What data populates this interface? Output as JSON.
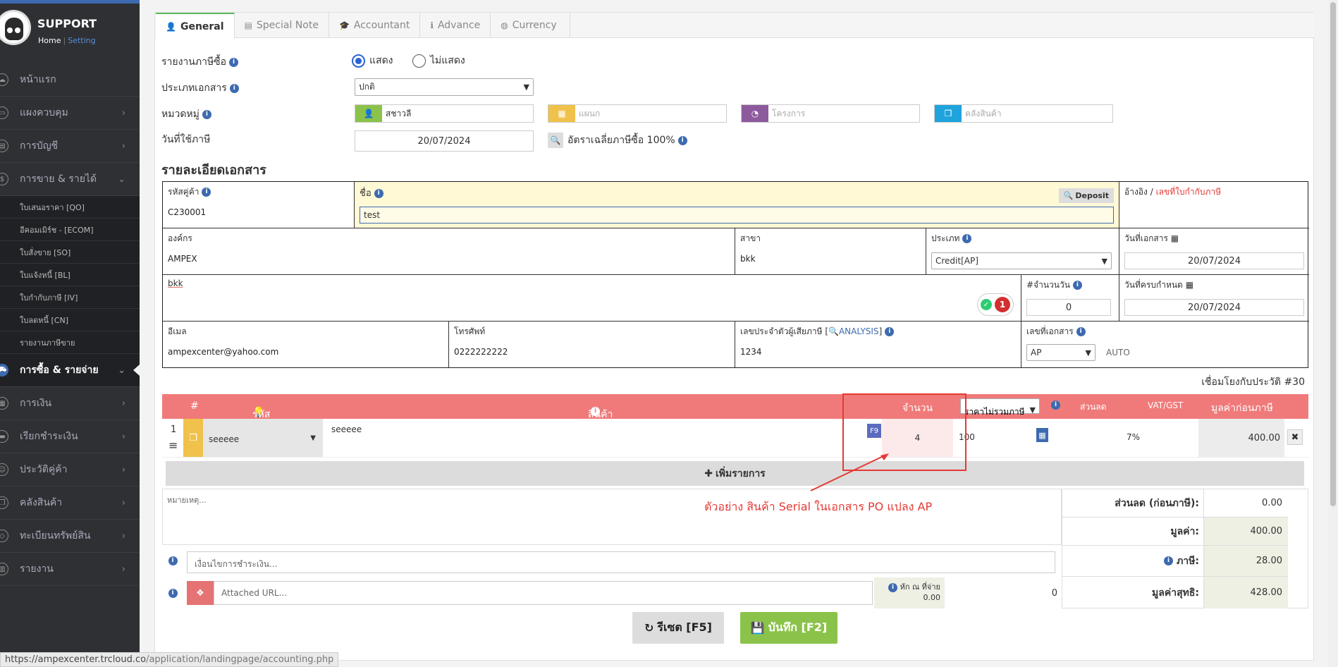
{
  "sidebar": {
    "brand": "SUPPORT",
    "home": "Home",
    "sep": "|",
    "setting": "Setting",
    "menu": [
      {
        "label": "หน้าแรก",
        "icon": "cloud-icon"
      },
      {
        "label": "แผงควบคุม",
        "icon": "monitor-icon"
      },
      {
        "label": "การบัญชี",
        "icon": "book-icon"
      },
      {
        "label": "การขาย & รายได้",
        "icon": "dollar-icon"
      },
      {
        "label": "การซื้อ & รายจ่าย",
        "icon": "cart-icon"
      },
      {
        "label": "การเงิน",
        "icon": "calendar-icon"
      },
      {
        "label": "เรียกชำระเงิน",
        "icon": "card-icon"
      },
      {
        "label": "ประวัติคู่ค้า",
        "icon": "contact-icon"
      },
      {
        "label": "คลังสินค้า",
        "icon": "cubes-icon"
      },
      {
        "label": "ทะเบียนทรัพย์สิน",
        "icon": "diamond-icon"
      },
      {
        "label": "รายงาน",
        "icon": "report-icon"
      }
    ],
    "sales_sub": [
      "ใบเสนอราคา [QO]",
      "อีคอมเมิร์ช - [ECOM]",
      "ใบสั่งขาย [SO]",
      "ใบแจ้งหนี้ [BL]",
      "ใบกำกับภาษี [IV]",
      "ใบลดหนี้ [CN]",
      "รายงานภาษีขาย"
    ]
  },
  "tabs": [
    "General",
    "Special Note",
    "Accountant",
    "Advance",
    "Currency"
  ],
  "form": {
    "tax_report_label": "รายงานภาษีซื้อ",
    "show": "แสดง",
    "hide": "ไม่แสดง",
    "doc_type_label": "ประเภทเอกสาร",
    "doc_type_value": "ปกติ",
    "category_label": "หมวดหมู่",
    "category_person": "สชาวลี",
    "category_dept": "แผนก",
    "category_project": "โครงการ",
    "category_warehouse": "คลังสินค้า",
    "tax_date_label": "วันที่ใช้ภาษี",
    "tax_date": "20/07/2024",
    "avg_tax": "อัตราเฉลี่ยภาษีซื้อ 100%"
  },
  "details": {
    "heading": "รายละเอียดเอกสาร",
    "vendor_code_label": "รหัสคู่ค้า",
    "vendor_code": "C230001",
    "name_label": "ชื่อ",
    "name_value": "test",
    "deposit": "Deposit",
    "ref_label": "อ้างอิง",
    "ref_sep": "/",
    "ref_taxinv": "เลขที่ใบกำกับภาษี",
    "org_label": "องค์กร",
    "org": "AMPEX",
    "branch_label": "สาขา",
    "branch": "bkk",
    "type_label": "ประเภท",
    "type": "Credit[AP]",
    "docdate_label": "วันที่เอกสาร",
    "docdate": "20/07/2024",
    "address": "bkk",
    "badge": "1",
    "days_label": "#จำนวนวัน",
    "days": "0",
    "duedate_label": "วันที่ครบกำหนด",
    "duedate": "20/07/2024",
    "email_label": "อีเมล",
    "email": "ampexcenter@yahoo.com",
    "phone_label": "โทรศัพท์",
    "phone": "0222222222",
    "taxid_label": "เลขประจำตัวผู้เสียภาษี [",
    "analysis": "ANALYSIS",
    "taxid_close": "]",
    "taxid": "1234",
    "docno_label": "เลขที่เอกสาร",
    "docno_prefix": "AP",
    "auto": "AUTO",
    "link_history": "เชื่อมโยงกับประวัติ #30"
  },
  "grid": {
    "headers": {
      "num": "#",
      "code": "รหัส",
      "product": "สินค้า",
      "qty": "จำนวน",
      "price_mode": "ราคาไม่รวมภาษี",
      "discount": "ส่วนลด",
      "vat": "VAT/GST",
      "amount": "มูลค่าก่อนภาษี"
    },
    "rows": [
      {
        "no": "1",
        "code": "seeeee",
        "desc": "seeeee",
        "f9": "F9",
        "qty": "4",
        "price": "100",
        "discount": "",
        "vat": "7%",
        "amount": "400.00"
      }
    ],
    "add_row": "เพิ่มรายการ"
  },
  "footer": {
    "remark_placeholder": "หมายเหตุ...",
    "payment_placeholder": "เงื่อนไขการชำระเงิน...",
    "url_placeholder": "Attached URL...",
    "wht_label": "หัก ณ ที่จ่าย",
    "wht_value": "0.00",
    "wht_amount": "0",
    "discount_label": "ส่วนลด (ก่อนภาษี):",
    "discount_value": "0.00",
    "value_label": "มูลค่า:",
    "value": "400.00",
    "tax_label": "ภาษี:",
    "tax": "28.00",
    "net_label": "มูลค่าสุทธิ:",
    "net": "428.00"
  },
  "annotation": "ตัวอย่าง สินค้า Serial ในเอกสาร PO  แปลง AP",
  "buttons": {
    "reset": "รีเซต [F5]",
    "save": "บันทึก [F2]"
  },
  "status_url_host": "https://ampexcenter.trcloud.co",
  "status_url_path": "/application/landingpage/accounting.php",
  "colors": {
    "accent": "#3d6ab0",
    "header_red": "#f07a7a",
    "green": "#8bc34a",
    "annotation_red": "#e53935"
  }
}
